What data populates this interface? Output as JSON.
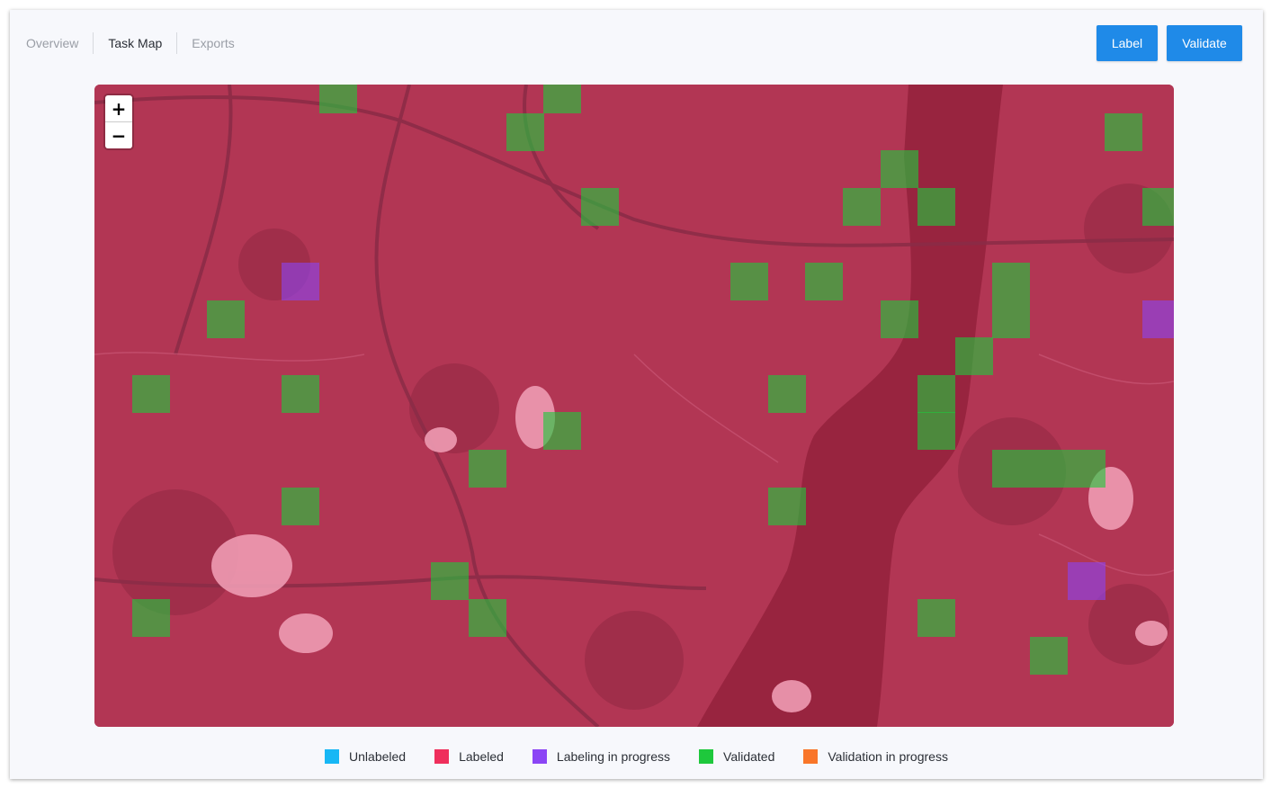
{
  "tabs": [
    {
      "label": "Overview",
      "active": false
    },
    {
      "label": "Task Map",
      "active": true
    },
    {
      "label": "Exports",
      "active": false
    }
  ],
  "actions": {
    "label_button": "Label",
    "validate_button": "Validate"
  },
  "map": {
    "zoom_in": "+",
    "zoom_out": "−",
    "grid": {
      "cols": 29,
      "rows": 17,
      "default_status": "labeled"
    },
    "tiles": [
      {
        "col": 6,
        "row": 0,
        "status": "validated"
      },
      {
        "col": 12,
        "row": 0,
        "status": "validated"
      },
      {
        "col": 11,
        "row": 1,
        "status": "validated"
      },
      {
        "col": 27,
        "row": 1,
        "status": "validated"
      },
      {
        "col": 21,
        "row": 2,
        "status": "validated"
      },
      {
        "col": 13,
        "row": 3,
        "status": "validated"
      },
      {
        "col": 20,
        "row": 3,
        "status": "validated"
      },
      {
        "col": 22,
        "row": 3,
        "status": "validated"
      },
      {
        "col": 28,
        "row": 3,
        "status": "validated"
      },
      {
        "col": 5,
        "row": 5,
        "status": "labeling_in_progress"
      },
      {
        "col": 17,
        "row": 5,
        "status": "validated"
      },
      {
        "col": 19,
        "row": 5,
        "status": "validated"
      },
      {
        "col": 24,
        "row": 5,
        "status": "validated"
      },
      {
        "col": 3,
        "row": 6,
        "status": "validated"
      },
      {
        "col": 21,
        "row": 6,
        "status": "validated"
      },
      {
        "col": 24,
        "row": 6,
        "status": "validated"
      },
      {
        "col": 28,
        "row": 6,
        "status": "labeling_in_progress"
      },
      {
        "col": 23,
        "row": 7,
        "status": "validated"
      },
      {
        "col": 1,
        "row": 8,
        "status": "validated"
      },
      {
        "col": 5,
        "row": 8,
        "status": "validated"
      },
      {
        "col": 18,
        "row": 8,
        "status": "validated"
      },
      {
        "col": 22,
        "row": 8,
        "status": "validated"
      },
      {
        "col": 12,
        "row": 9,
        "status": "validated"
      },
      {
        "col": 22,
        "row": 9,
        "status": "validated"
      },
      {
        "col": 10,
        "row": 10,
        "status": "validated"
      },
      {
        "col": 24,
        "row": 10,
        "status": "validated"
      },
      {
        "col": 25,
        "row": 10,
        "status": "validated"
      },
      {
        "col": 26,
        "row": 10,
        "status": "validated"
      },
      {
        "col": 5,
        "row": 11,
        "status": "validated"
      },
      {
        "col": 18,
        "row": 11,
        "status": "validated"
      },
      {
        "col": 9,
        "row": 13,
        "status": "validated"
      },
      {
        "col": 26,
        "row": 13,
        "status": "labeling_in_progress"
      },
      {
        "col": 1,
        "row": 14,
        "status": "validated"
      },
      {
        "col": 10,
        "row": 14,
        "status": "validated"
      },
      {
        "col": 22,
        "row": 14,
        "status": "validated"
      },
      {
        "col": 25,
        "row": 15,
        "status": "validated"
      }
    ]
  },
  "legend": [
    {
      "key": "unlabeled",
      "label": "Unlabeled",
      "color": "#17b7f5"
    },
    {
      "key": "labeled",
      "label": "Labeled",
      "color": "#ef2f5c"
    },
    {
      "key": "labeling_in_progress",
      "label": "Labeling in progress",
      "color": "#8b45f5"
    },
    {
      "key": "validated",
      "label": "Validated",
      "color": "#1ec83c"
    },
    {
      "key": "validation_in_progress",
      "label": "Validation in progress",
      "color": "#f97629"
    }
  ]
}
